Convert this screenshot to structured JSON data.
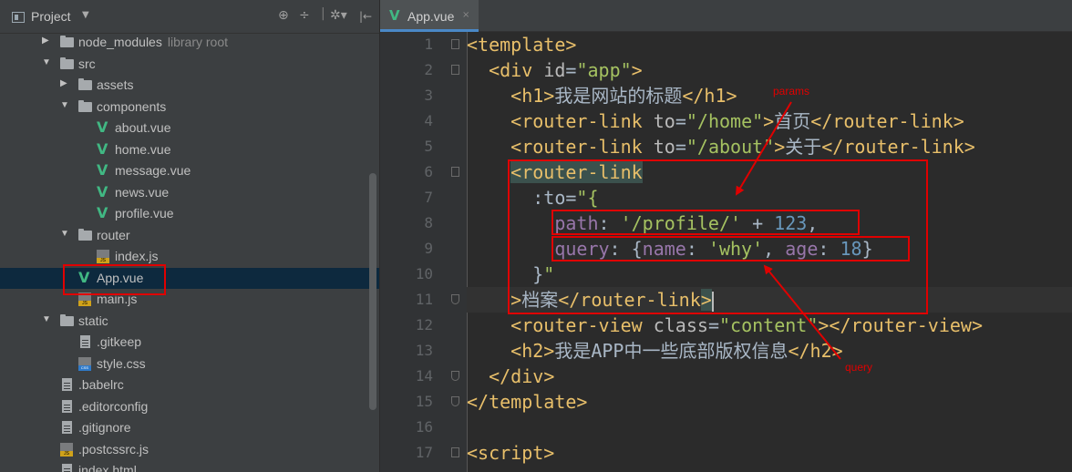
{
  "sidebar": {
    "title": "Project",
    "dropdown_icon": "caret-down-icon",
    "tools": {
      "sync": "⊕",
      "collapse": "÷",
      "settings": "✲▾",
      "hide": "|←"
    },
    "tree": [
      {
        "name": "node_modules",
        "suffix": "library root",
        "type": "folder",
        "expanded": false
      },
      {
        "name": "src",
        "type": "folder",
        "expanded": true
      },
      {
        "name": "assets",
        "type": "folder",
        "expanded": false
      },
      {
        "name": "components",
        "type": "folder",
        "expanded": true
      },
      {
        "name": "about.vue",
        "type": "vue"
      },
      {
        "name": "home.vue",
        "type": "vue"
      },
      {
        "name": "message.vue",
        "type": "vue"
      },
      {
        "name": "news.vue",
        "type": "vue"
      },
      {
        "name": "profile.vue",
        "type": "vue"
      },
      {
        "name": "router",
        "type": "folder",
        "expanded": true
      },
      {
        "name": "index.js",
        "type": "js"
      },
      {
        "name": "App.vue",
        "type": "vue",
        "selected": true
      },
      {
        "name": "main.js",
        "type": "js"
      },
      {
        "name": "static",
        "type": "folder",
        "expanded": true
      },
      {
        "name": ".gitkeep",
        "type": "file"
      },
      {
        "name": "style.css",
        "type": "css"
      },
      {
        "name": ".babelrc",
        "type": "file"
      },
      {
        "name": ".editorconfig",
        "type": "file"
      },
      {
        "name": ".gitignore",
        "type": "file"
      },
      {
        "name": ".postcssrc.js",
        "type": "js"
      },
      {
        "name": "index.html",
        "type": "file"
      }
    ]
  },
  "editor": {
    "tab": {
      "label": "App.vue",
      "close": "×"
    },
    "line_numbers": [
      "1",
      "2",
      "3",
      "4",
      "5",
      "6",
      "7",
      "8",
      "9",
      "10",
      "11",
      "12",
      "13",
      "14",
      "15",
      "16",
      "17"
    ],
    "lines": [
      "<template>",
      "  <div id=\"app\">",
      "    <h1>我是网站的标题</h1>",
      "    <router-link to=\"/home\">首页</router-link>",
      "    <router-link to=\"/about\">关于</router-link>",
      "    <router-link",
      "      :to=\"{",
      "        path: '/profile/' + 123,",
      "        query: {name: 'why', age: 18}",
      "      }\"",
      "    >档案</router-link>",
      "    <router-view class=\"content\"></router-view>",
      "    <h2>我是APP中一些底部版权信息</h2>",
      "  </div>",
      "</template>",
      "",
      "<script>"
    ]
  },
  "annotations": {
    "params_label": "params",
    "query_label": "query",
    "color": "#e00000"
  },
  "colors": {
    "tag": "#e8bf6a",
    "string": "#a5c261",
    "key": "#9876aa",
    "number": "#6897bb",
    "vue": "#41b883",
    "selection": "#0d293e"
  }
}
